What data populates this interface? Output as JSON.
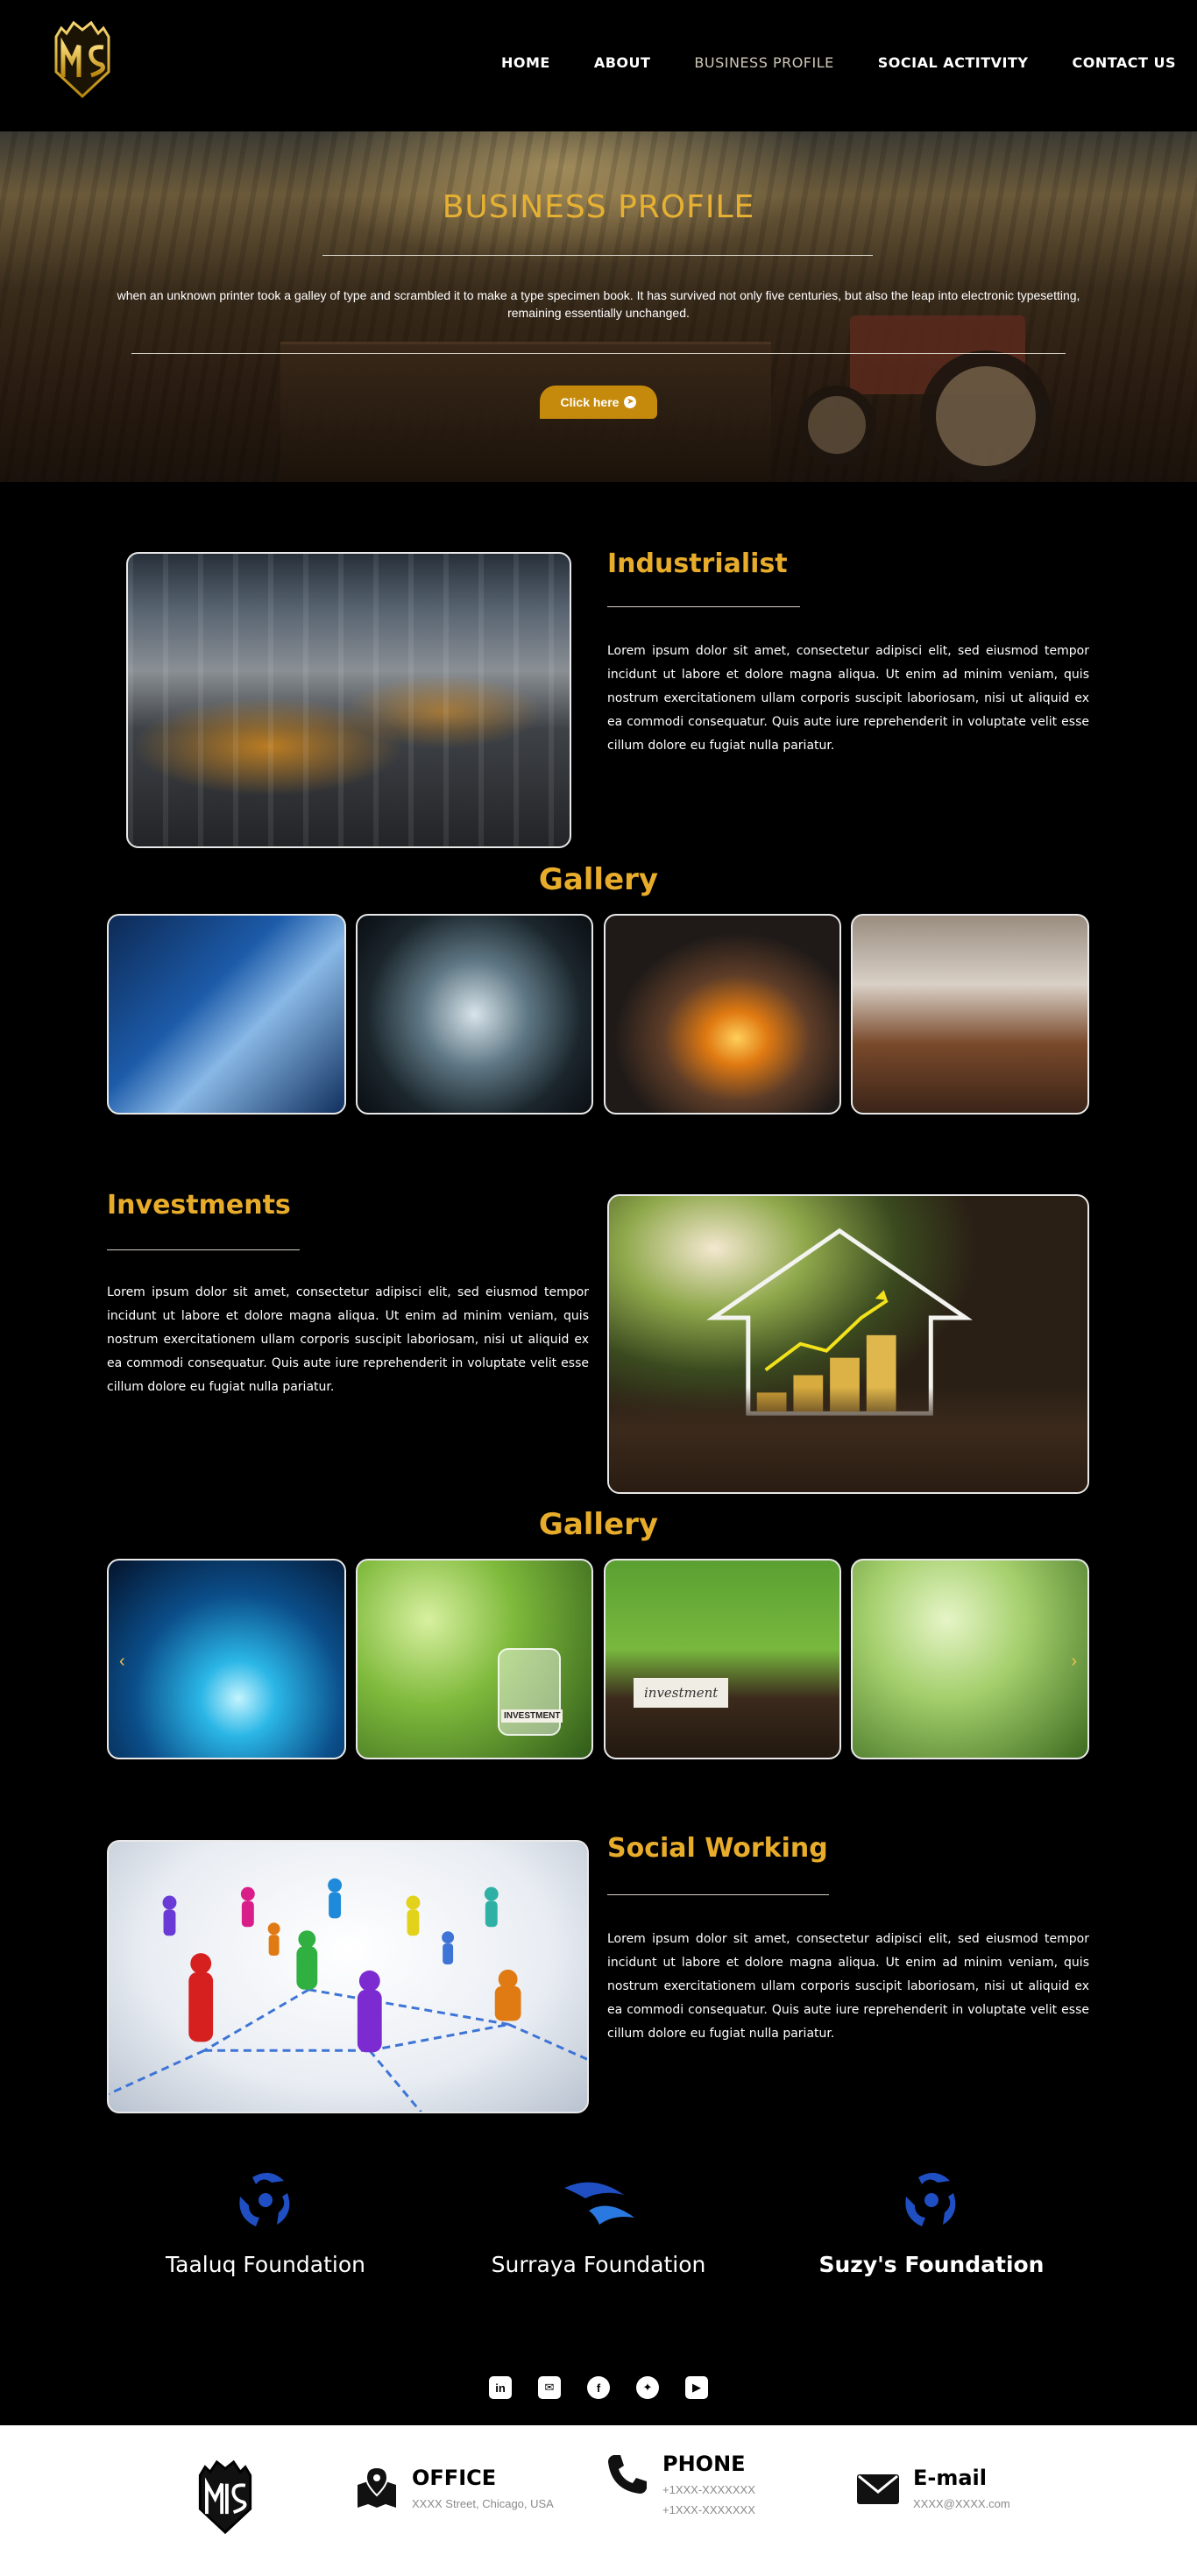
{
  "header": {
    "logo_alt": "MIS",
    "nav": [
      {
        "label": "HOME",
        "active": false
      },
      {
        "label": "ABOUT",
        "active": false
      },
      {
        "label": "BUSINESS PROFILE",
        "active": true
      },
      {
        "label": "SOCIAL ACTITVITY",
        "active": false
      },
      {
        "label": "CONTACT US",
        "active": false
      }
    ]
  },
  "hero": {
    "title": "BUSINESS PROFILE",
    "text": "when an unknown printer took a galley of type and scrambled it to make a type specimen book. It has survived not only five centuries, but also the leap into electronic typesetting, remaining essentially unchanged.",
    "button": "Click here"
  },
  "sections": [
    {
      "title": "Industrialist",
      "text": "Lorem ipsum dolor sit amet, consectetur adipisci elit, sed eiusmod tempor incidunt ut labore et dolore magna aliqua. Ut enim ad minim veniam, quis nostrum exercitationem ullam corporis suscipit laboriosam, nisi ut aliquid ex ea commodi consequatur. Quis aute iure reprehenderit in voluptate velit esse cillum dolore eu fugiat nulla pariatur."
    },
    {
      "title": "Investments",
      "text": "Lorem ipsum dolor sit amet, consectetur adipisci elit, sed eiusmod tempor incidunt ut labore et dolore magna aliqua. Ut enim ad minim veniam, quis nostrum exercitationem ullam corporis suscipit laboriosam, nisi ut aliquid ex ea commodi consequatur. Quis aute iure reprehenderit in voluptate velit esse cillum dolore eu fugiat nulla pariatur."
    },
    {
      "title": "Social Working",
      "text": "Lorem ipsum dolor sit amet, consectetur adipisci elit, sed eiusmod tempor incidunt ut labore et dolore magna aliqua. Ut enim ad minim veniam, quis nostrum exercitationem ullam corporis suscipit laboriosam, nisi ut aliquid ex ea commodi consequatur. Quis aute iure reprehenderit in voluptate velit esse cillum dolore eu fugiat nulla pariatur."
    }
  ],
  "gallery_title": "Gallery",
  "gallery2_label": "investment",
  "gallery2_jar_label": "INVESTMENT",
  "foundations": [
    {
      "name": "Taaluq Foundation",
      "icon": "foundation-swirl-icon"
    },
    {
      "name": "Surraya Foundation",
      "icon": "foundation-wave-icon"
    },
    {
      "name": "Suzy's Foundation",
      "icon": "foundation-swirl-icon"
    }
  ],
  "social_icons": [
    "linkedin-icon",
    "email-icon",
    "facebook-icon",
    "twitter-icon",
    "youtube-icon"
  ],
  "footer": {
    "office": {
      "title": "OFFICE",
      "lines": [
        "XXXX Street, Chicago, USA"
      ]
    },
    "phone": {
      "title": "PHONE",
      "lines": [
        "+1XXX-XXXXXXX",
        "+1XXX-XXXXXXX"
      ]
    },
    "email": {
      "title": "E-mail",
      "lines": [
        "XXXX@XXXX.com"
      ]
    }
  },
  "colors": {
    "accent": "#e8ac2b",
    "button": "#c58a0c",
    "background": "#000000",
    "footer": "#ffffff"
  }
}
